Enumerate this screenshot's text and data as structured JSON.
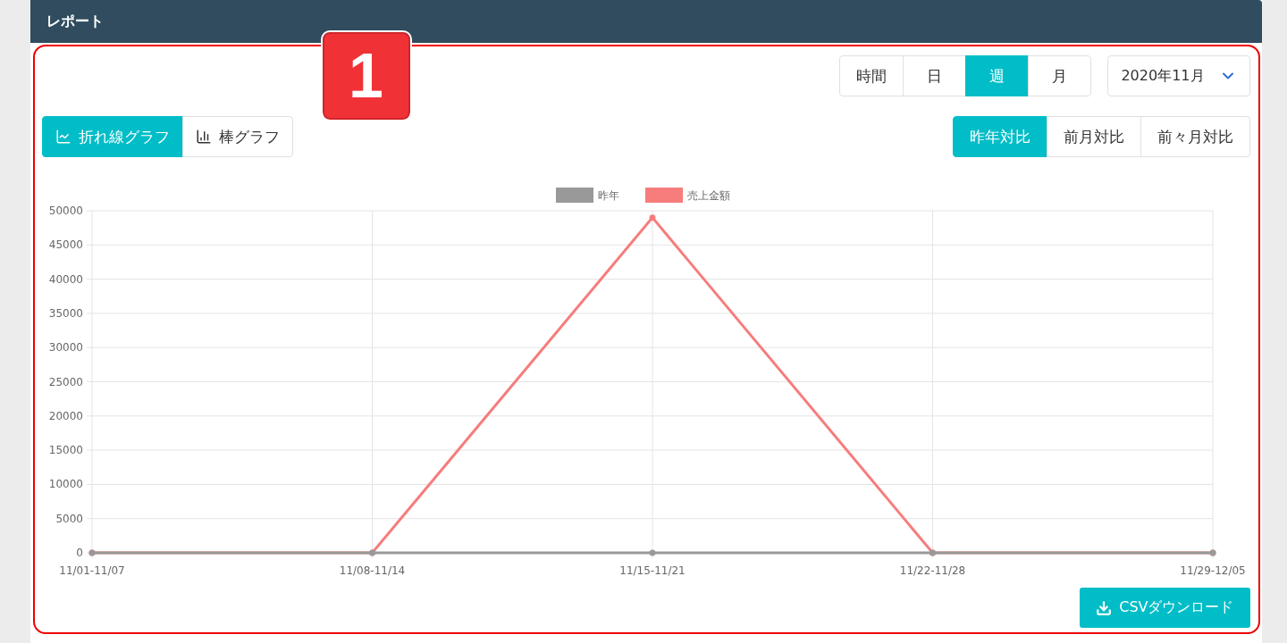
{
  "header": {
    "title": "レポート"
  },
  "annotation": {
    "label": "1"
  },
  "period_tabs": [
    {
      "label": "時間",
      "selected": false
    },
    {
      "label": "日",
      "selected": false
    },
    {
      "label": "週",
      "selected": true
    },
    {
      "label": "月",
      "selected": false
    }
  ],
  "month_select": {
    "value": "2020年11月"
  },
  "chart_types": [
    {
      "label": "折れ線グラフ",
      "kind": "line",
      "selected": true
    },
    {
      "label": "棒グラフ",
      "kind": "bar",
      "selected": false
    }
  ],
  "comparisons": [
    {
      "label": "昨年対比",
      "selected": true
    },
    {
      "label": "前月対比",
      "selected": false
    },
    {
      "label": "前々月対比",
      "selected": false
    }
  ],
  "chart_data": {
    "type": "line",
    "grid": true,
    "legend": true,
    "categories": [
      "11/01-11/07",
      "11/08-11/14",
      "11/15-11/21",
      "11/22-11/28",
      "11/29-12/05"
    ],
    "ylim": [
      0,
      50000
    ],
    "yticks": [
      0,
      5000,
      10000,
      15000,
      20000,
      25000,
      30000,
      35000,
      40000,
      45000,
      50000
    ],
    "series": [
      {
        "name": "昨年",
        "color": "#999999",
        "values": [
          0,
          0,
          0,
          0,
          0
        ],
        "marker": "circle"
      },
      {
        "name": "売上金額",
        "color": "#f77c7c",
        "values": [
          0,
          0,
          49000,
          0,
          0
        ],
        "marker": "circle"
      }
    ]
  },
  "csv_button": {
    "label": "CSVダウンロード"
  }
}
